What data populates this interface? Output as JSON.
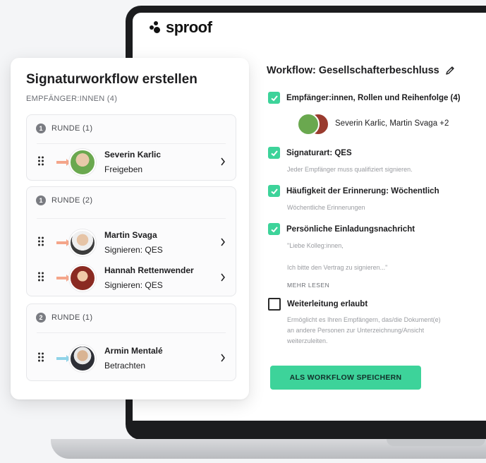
{
  "app": {
    "logo": "sproof"
  },
  "create_card": {
    "title": "Signaturworkflow erstellen",
    "recipients_header": "EMPFÄNGER:INNEN (4)",
    "rounds": [
      {
        "num": "1",
        "label": "RUNDE (1)",
        "people": [
          {
            "name": "Severin Karlic",
            "role": "Freigeben",
            "arrow_color": "#f4a58a"
          }
        ]
      },
      {
        "num": "1",
        "label": "RUNDE (2)",
        "people": [
          {
            "name": "Martin Svaga",
            "role": "Signieren: QES",
            "arrow_color": "#f4a58a"
          },
          {
            "name": "Hannah Rettenwender",
            "role": "Signieren: QES",
            "arrow_color": "#f4a58a"
          }
        ]
      },
      {
        "num": "2",
        "label": "RUNDE (1)",
        "people": [
          {
            "name": "Armin Mentalé",
            "role": "Betrachten",
            "arrow_color": "#8fd3e8"
          }
        ]
      }
    ]
  },
  "workflow": {
    "title": "Workflow: Gesellschafterbeschluss",
    "options": {
      "recipients": {
        "label": "Empfänger:innen, Rollen und Reihenfolge (4)",
        "summary": "Severin Karlic, Martin Svaga +2",
        "checked": true
      },
      "signature_type": {
        "label": "Signaturart: QES",
        "desc": "Jeder Empfänger muss qualifiziert signieren.",
        "checked": true
      },
      "reminder": {
        "label": "Häufigkeit der Erinnerung: Wöchentlich",
        "desc": "Wöchentliche Erinnerungen",
        "checked": true
      },
      "invitation": {
        "label": "Persönliche Einladungsnachricht",
        "desc_line1": "\"Liebe Kolleg:innen,",
        "desc_line2": "Ich bitte den Vertrag zu signieren...\"",
        "more": "MEHR LESEN",
        "checked": true
      },
      "forwarding": {
        "label": "Weiterleitung erlaubt",
        "desc": "Ermöglicht es Ihren Empfängern, das/die Dokument(e) an andere Personen zur Unterzeichnung/Ansicht weiterzuleiten.",
        "checked": false
      }
    },
    "save_button": "ALS WORKFLOW SPEICHERN"
  },
  "colors": {
    "accent_green": "#3dd39a",
    "text_dark": "#1d1d1f",
    "muted": "#9a9ca1"
  }
}
